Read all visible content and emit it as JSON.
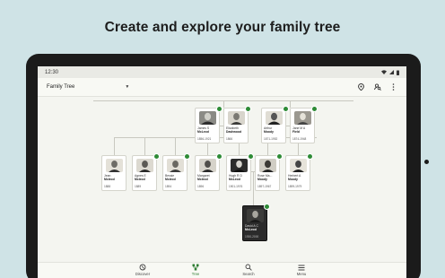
{
  "headline": "Create and explore your family tree",
  "status_bar": {
    "time": "12:30",
    "icons": [
      "wifi-icon",
      "signal-icon",
      "battery-icon"
    ]
  },
  "app_bar": {
    "title": "Family Tree",
    "dropdown_icon": "chevron-down-icon",
    "actions": [
      "location-pin-icon",
      "person-search-icon",
      "overflow-menu-icon"
    ]
  },
  "colors": {
    "accent": "#2e8b36",
    "background": "#cfe3e6",
    "tree_canvas": "#f4f5f0"
  },
  "tree": {
    "grandparents": [
      {
        "name1": "James S",
        "name2": "McLeod",
        "dates": "1856-1921"
      },
      {
        "name1": "Elizabeth",
        "name2": "Dashwood",
        "dates": "1866"
      },
      {
        "name1": "Arthur",
        "name2": "Moody",
        "dates": "1871-1952"
      },
      {
        "name1": "Jane M A",
        "name2": "Field",
        "dates": "1874-1948"
      }
    ],
    "children": [
      {
        "name1": "Jean",
        "name2": "Mcleod",
        "dates": "1888"
      },
      {
        "name1": "Agnes E",
        "name2": "Mcleod",
        "dates": "1889"
      },
      {
        "name1": "Bessie",
        "name2": "Mcleod",
        "dates": "1894"
      },
      {
        "name1": "Margaret",
        "name2": "Mcleod",
        "dates": "1896"
      },
      {
        "name1": "Hugh R D",
        "name2": "McLeod",
        "dates": "1901-1976"
      },
      {
        "name1": "Rose Ma...",
        "name2": "Moody",
        "dates": "1897-1967"
      },
      {
        "name1": "Herbert A",
        "name2": "Moody",
        "dates": "1899-1979"
      }
    ],
    "focus": {
      "name1": "David A C",
      "name2": "McLeod",
      "dates": "1930-2000"
    }
  },
  "bottom_nav": [
    {
      "label": "Discover",
      "icon": "discover-icon"
    },
    {
      "label": "Tree",
      "icon": "tree-icon"
    },
    {
      "label": "Search",
      "icon": "search-icon"
    },
    {
      "label": "Menu",
      "icon": "menu-icon"
    }
  ]
}
